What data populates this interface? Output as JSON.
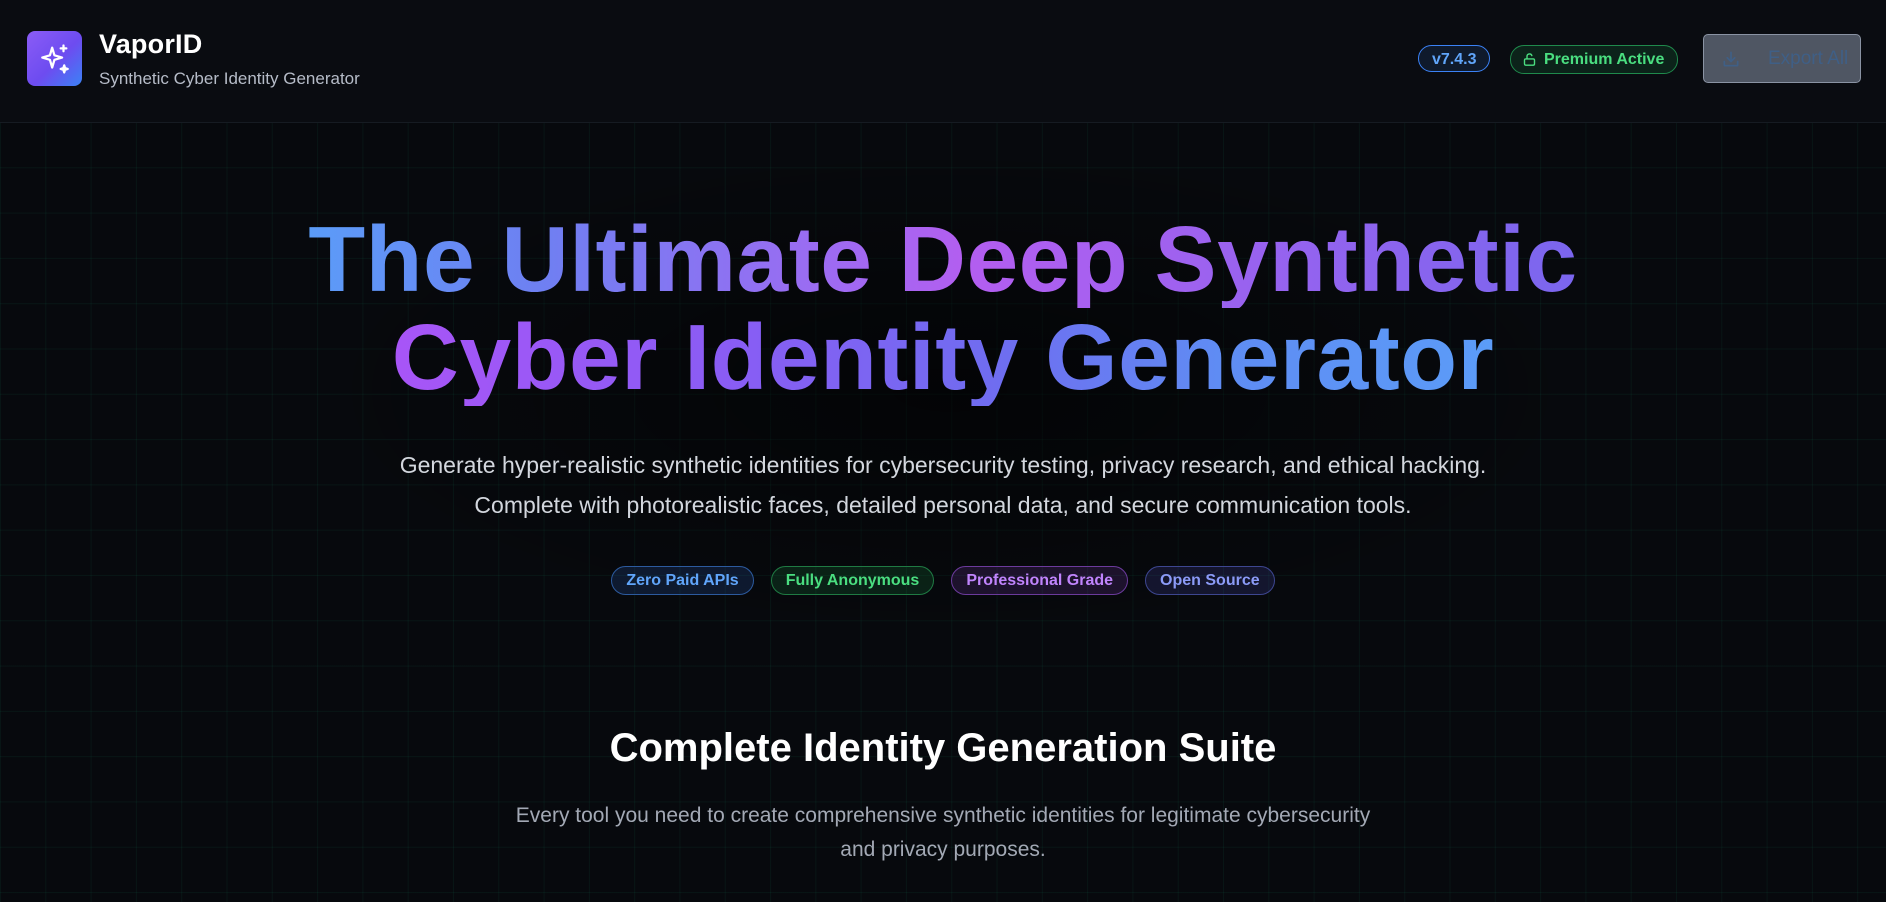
{
  "header": {
    "brand_name": "VaporID",
    "brand_subtitle": "Synthetic Cyber Identity Generator",
    "logo_icon": "sparkles-icon",
    "version": "v7.4.3",
    "premium_label": "Premium Active",
    "premium_icon": "unlock-icon",
    "export_label": "Export All",
    "export_icon": "download-icon"
  },
  "hero": {
    "title_line1": "The Ultimate Deep Synthetic",
    "title_line2": "Cyber Identity Generator",
    "description_line1": "Generate hyper-realistic synthetic identities for cybersecurity testing, privacy research, and ethical hacking.",
    "description_line2": "Complete with photorealistic faces, detailed personal data, and secure communication tools.",
    "tags": [
      {
        "label": "Zero Paid APIs",
        "color": "#60a5fa"
      },
      {
        "label": "Fully Anonymous",
        "color": "#4ade80"
      },
      {
        "label": "Professional Grade",
        "color": "#c084fc"
      },
      {
        "label": "Open Source",
        "color": "#8b9bf7"
      }
    ]
  },
  "suite": {
    "title": "Complete Identity Generation Suite",
    "description_line1": "Every tool you need to create comprehensive synthetic identities for legitimate cybersecurity",
    "description_line2": "and privacy purposes."
  },
  "colors": {
    "background": "#07090d",
    "accent_blue": "#3b82f6",
    "accent_purple": "#a855f7",
    "accent_green": "#22c55e"
  }
}
